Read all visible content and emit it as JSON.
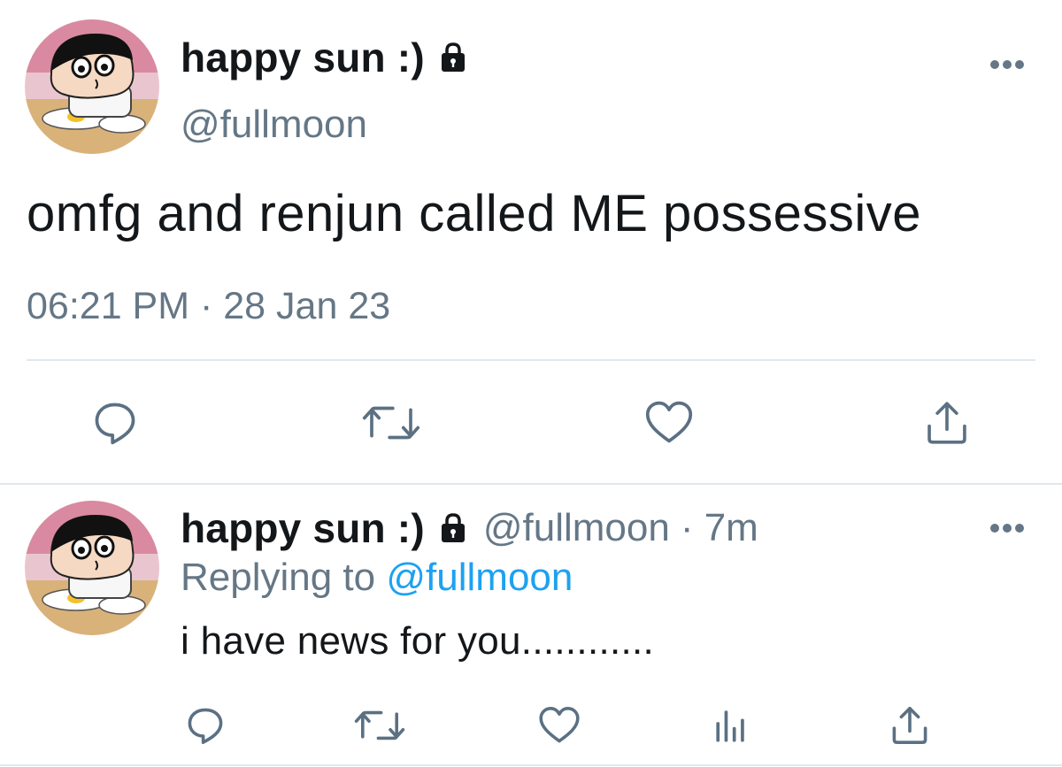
{
  "main_tweet": {
    "display_name": "happy sun :)",
    "handle": "@fullmoon",
    "text": "omfg and renjun called ME possessive",
    "timestamp": "06:21 PM · 28 Jan 23",
    "icons": [
      "lock-icon",
      "more-icon",
      "reply-icon",
      "retweet-icon",
      "like-icon",
      "share-icon"
    ]
  },
  "reply_tweet": {
    "display_name": "happy sun :)",
    "handle": "@fullmoon",
    "time_ago": "· 7m",
    "replying_prefix": "Replying to",
    "replying_to": "@fullmoon",
    "text": "i have news for you............",
    "icons": [
      "lock-icon",
      "more-icon",
      "reply-icon",
      "retweet-icon",
      "like-icon",
      "analytics-icon",
      "share-icon"
    ]
  },
  "colors": {
    "text_primary": "#14171a",
    "text_secondary": "#657786",
    "link": "#1da1f2",
    "divider": "#e1e8ed",
    "icon": "#5b7083"
  }
}
